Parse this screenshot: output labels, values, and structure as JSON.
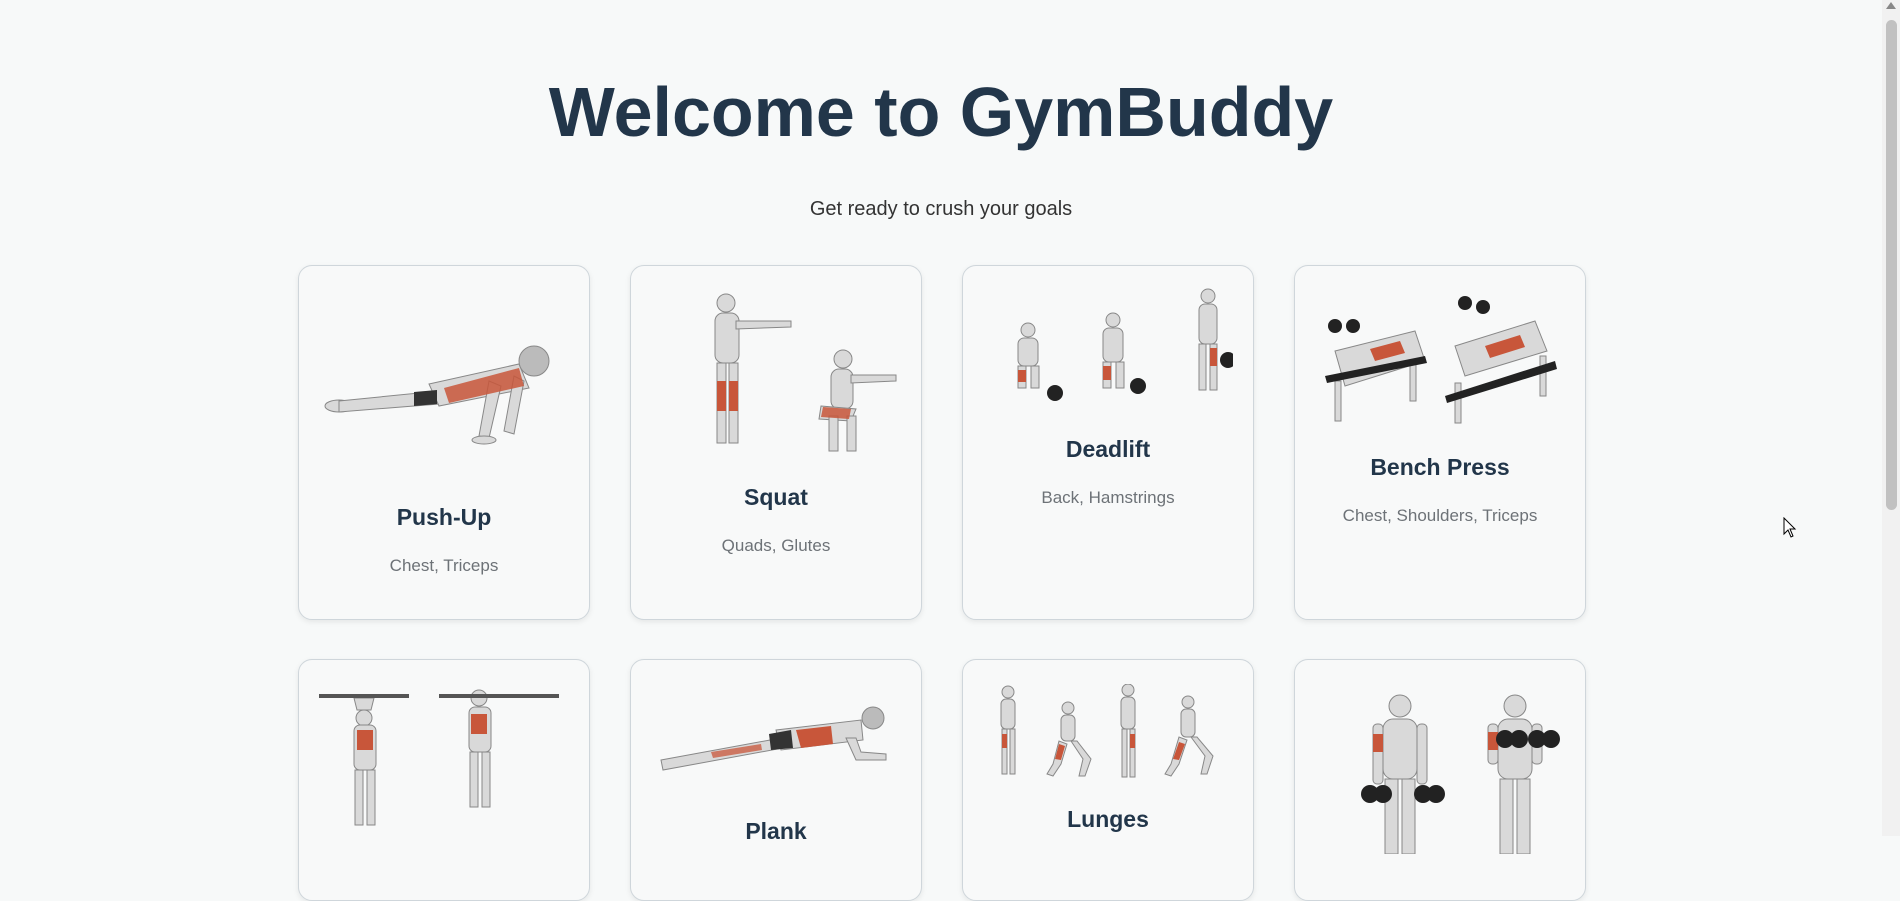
{
  "hero": {
    "title": "Welcome to GymBuddy",
    "subtitle": "Get ready to crush your goals"
  },
  "exercises": [
    {
      "name": "Push-Up",
      "muscles": "Chest, Triceps",
      "icon": "push-up-illustration"
    },
    {
      "name": "Squat",
      "muscles": "Quads, Glutes",
      "icon": "squat-illustration"
    },
    {
      "name": "Deadlift",
      "muscles": "Back, Hamstrings",
      "icon": "deadlift-illustration"
    },
    {
      "name": "Bench Press",
      "muscles": "Chest, Shoulders, Triceps",
      "icon": "bench-press-illustration"
    },
    {
      "name": "",
      "muscles": "",
      "icon": "pull-up-illustration"
    },
    {
      "name": "Plank",
      "muscles": "",
      "icon": "plank-illustration"
    },
    {
      "name": "Lunges",
      "muscles": "",
      "icon": "lunges-illustration"
    },
    {
      "name": "",
      "muscles": "",
      "icon": "bicep-curl-illustration"
    }
  ],
  "colors": {
    "title": "#22364a",
    "muscle_highlight": "#c8563a",
    "background": "#f7f9f9"
  }
}
